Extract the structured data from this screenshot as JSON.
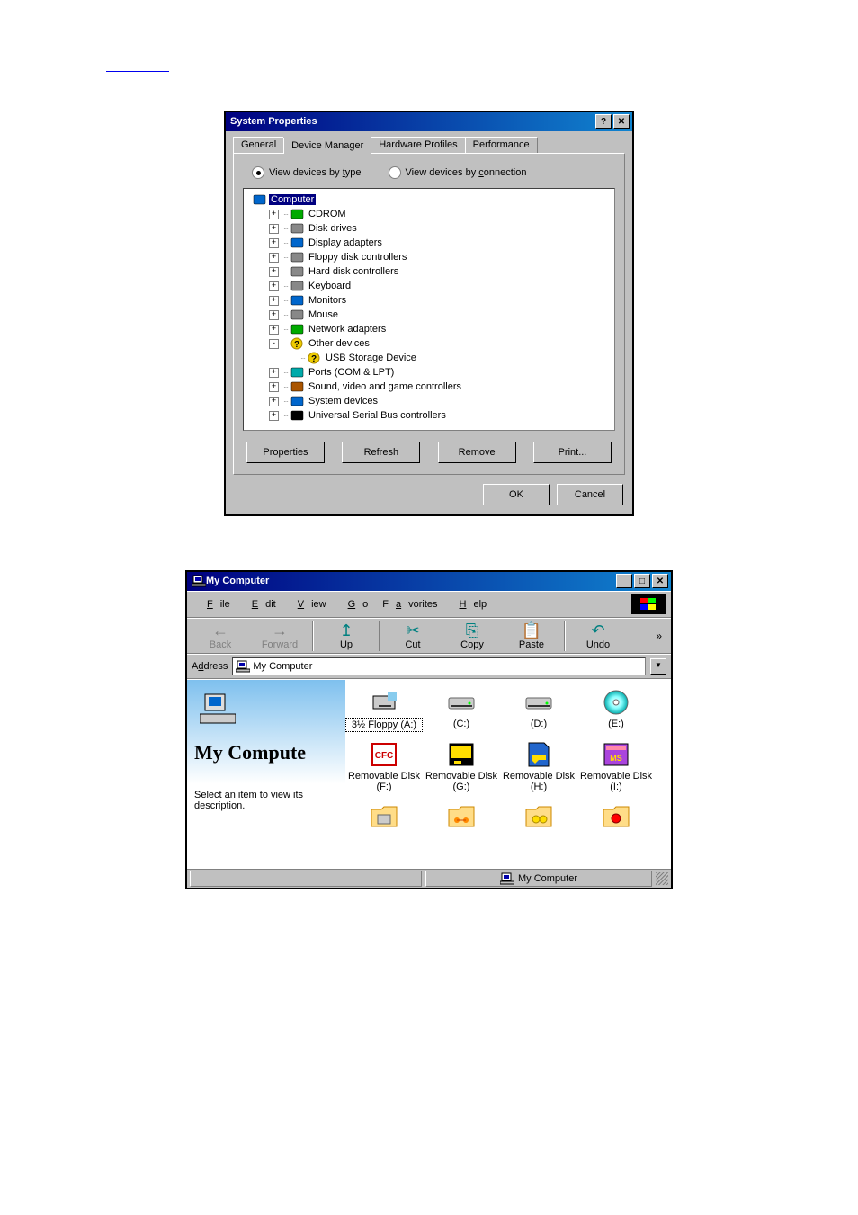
{
  "sysprops": {
    "title": "System Properties",
    "tabs": [
      "General",
      "Device Manager",
      "Hardware Profiles",
      "Performance"
    ],
    "active_tab": 1,
    "radio_type": "View devices by type",
    "radio_conn": "View devices by connection",
    "tree": [
      {
        "indent": 0,
        "exp": "",
        "icon": "computer",
        "label": "Computer",
        "sel": true
      },
      {
        "indent": 1,
        "exp": "+",
        "icon": "cdrom",
        "label": "CDROM"
      },
      {
        "indent": 1,
        "exp": "+",
        "icon": "disk",
        "label": "Disk drives"
      },
      {
        "indent": 1,
        "exp": "+",
        "icon": "display",
        "label": "Display adapters"
      },
      {
        "indent": 1,
        "exp": "+",
        "icon": "floppyctrl",
        "label": "Floppy disk controllers"
      },
      {
        "indent": 1,
        "exp": "+",
        "icon": "hddctrl",
        "label": "Hard disk controllers"
      },
      {
        "indent": 1,
        "exp": "+",
        "icon": "keyboard",
        "label": "Keyboard"
      },
      {
        "indent": 1,
        "exp": "+",
        "icon": "monitor",
        "label": "Monitors"
      },
      {
        "indent": 1,
        "exp": "+",
        "icon": "mouse",
        "label": "Mouse"
      },
      {
        "indent": 1,
        "exp": "+",
        "icon": "network",
        "label": "Network adapters"
      },
      {
        "indent": 1,
        "exp": "-",
        "icon": "question",
        "label": "Other devices"
      },
      {
        "indent": 2,
        "exp": "",
        "icon": "question",
        "label": "USB Storage Device"
      },
      {
        "indent": 1,
        "exp": "+",
        "icon": "ports",
        "label": "Ports (COM & LPT)"
      },
      {
        "indent": 1,
        "exp": "+",
        "icon": "sound",
        "label": "Sound, video and game controllers"
      },
      {
        "indent": 1,
        "exp": "+",
        "icon": "system",
        "label": "System devices"
      },
      {
        "indent": 1,
        "exp": "+",
        "icon": "usb",
        "label": "Universal Serial Bus controllers"
      }
    ],
    "btn_properties": "Properties",
    "btn_refresh": "Refresh",
    "btn_remove": "Remove",
    "btn_print": "Print...",
    "btn_ok": "OK",
    "btn_cancel": "Cancel"
  },
  "mycomp": {
    "title": "My Computer",
    "menus": [
      "File",
      "Edit",
      "View",
      "Go",
      "Favorites",
      "Help"
    ],
    "tools": [
      {
        "name": "Back",
        "enabled": false,
        "glyph": "←"
      },
      {
        "name": "Forward",
        "enabled": false,
        "glyph": "→"
      },
      {
        "name": "Up",
        "enabled": true,
        "glyph": "↥"
      },
      {
        "name": "Cut",
        "enabled": true,
        "glyph": "✂"
      },
      {
        "name": "Copy",
        "enabled": true,
        "glyph": "⎘"
      },
      {
        "name": "Paste",
        "enabled": true,
        "glyph": "📋"
      },
      {
        "name": "Undo",
        "enabled": true,
        "glyph": "↶"
      }
    ],
    "address_label": "Address",
    "address_value": "My Computer",
    "left_title": "My Compute",
    "left_sub": "Select an item to view its description.",
    "icons": [
      {
        "label": "3½ Floppy (A:)",
        "sel": true,
        "type": "floppy"
      },
      {
        "label": "(C:)",
        "type": "hdd"
      },
      {
        "label": "(D:)",
        "type": "hdd"
      },
      {
        "label": "(E:)",
        "type": "cd"
      },
      {
        "label": "Removable Disk (F:)",
        "type": "cfc"
      },
      {
        "label": "Removable Disk (G:)",
        "type": "sm"
      },
      {
        "label": "Removable Disk (H:)",
        "type": "sd"
      },
      {
        "label": "Removable Disk (I:)",
        "type": "ms"
      },
      {
        "label": "",
        "type": "folder-print"
      },
      {
        "label": "",
        "type": "folder-net"
      },
      {
        "label": "",
        "type": "folder-dial"
      },
      {
        "label": "",
        "type": "folder-ctrl"
      }
    ],
    "status": "My Computer"
  }
}
